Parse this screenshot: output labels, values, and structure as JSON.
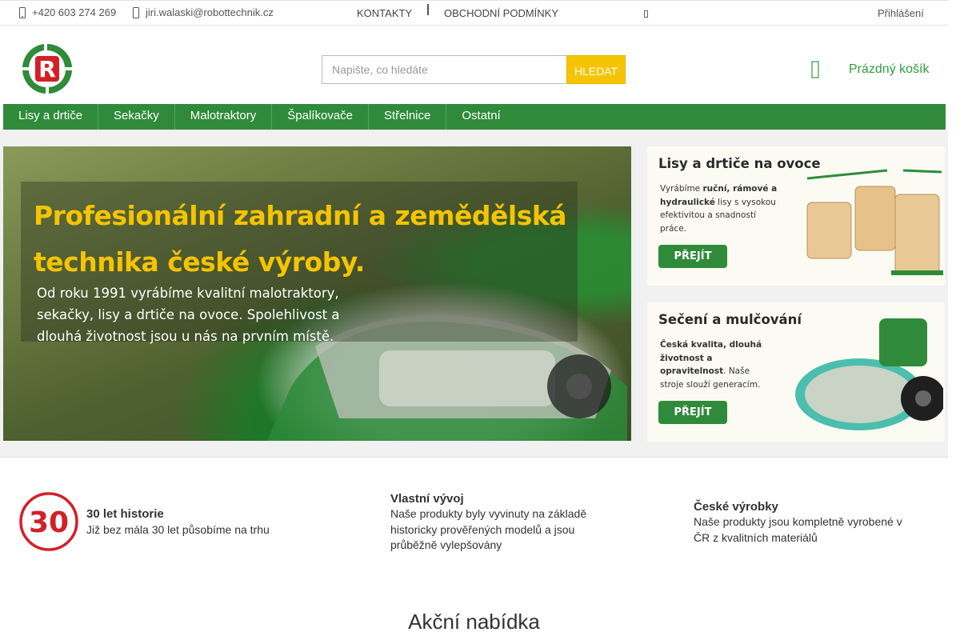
{
  "topbar": {
    "phone": "+420 603 274 269",
    "email": "jiri.walaski@robottechnik.cz",
    "links": [
      "Kontakty",
      "Obchodní podmínky"
    ],
    "login": "Přihlášení",
    "icons": [
      "phone-icon",
      "mail-icon",
      "small-icon"
    ]
  },
  "header": {
    "search": {
      "placeholder": "Napište, co hledáte",
      "button": "Hledat"
    },
    "cart": {
      "label": "Prázdný košík",
      "icon": "cart-icon"
    },
    "logo_letter": "R"
  },
  "nav": {
    "items": [
      "Lisy a drtiče",
      "Sekačky",
      "Malotraktory",
      "Špalíkovače",
      "Střelnice",
      "Ostatní"
    ]
  },
  "hero": {
    "title_line1": "Profesionální zahradní a zemědělská",
    "title_line2": "technika české výroby.",
    "text": "Od roku 1991 vyrábíme kvalitní malotraktory, sekačky, lisy a drtiče na ovoce. Spolehlivost a dlouhá životnost jsou u nás na prvním místě."
  },
  "promos": [
    {
      "title": "Lisy a drtiče na ovoce",
      "text_parts": [
        {
          "t": "Vyrábíme ",
          "b": false
        },
        {
          "t": "ruční, rámové a hydraulické",
          "b": true
        },
        {
          "t": " lisy s vysokou efektivitou a snadností práce.",
          "b": false
        }
      ],
      "button": "PŘEJÍT"
    },
    {
      "title": "Sečení a mulčování",
      "text_parts": [
        {
          "t": "Česká kvalita, dlouhá životnost a opravitelnost",
          "b": true
        },
        {
          "t": ". Naše stroje slouží generacím.",
          "b": false
        }
      ],
      "button": "PŘEJÍT"
    }
  ],
  "features": [
    {
      "badge": "30",
      "title": "30 let historie",
      "text": "Již bez mála 30 let působíme na trhu"
    },
    {
      "title": "Vlastní vývoj",
      "text": "Naše produkty byly vyvinuty na základě historicky prověřených modelů a jsou průběžně vylepšovány"
    },
    {
      "title": "České výrobky",
      "text": "Naše produkty jsou kompletně vyrobené v ČR z kvalitních materiálů"
    }
  ],
  "section": {
    "title": "Akční nabídka"
  },
  "colors": {
    "brand_green": "#2f8b3a",
    "accent_yellow": "#f5c400",
    "logo_red": "#d32027"
  }
}
